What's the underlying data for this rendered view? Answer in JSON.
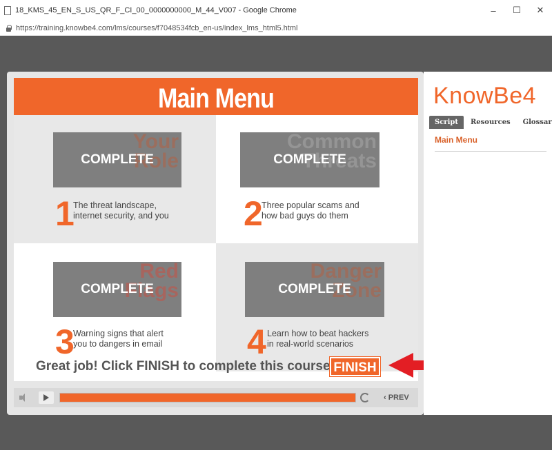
{
  "window": {
    "title": "18_KMS_45_EN_S_US_QR_F_CI_00_0000000000_M_44_V007 - Google Chrome",
    "minimize": "–",
    "maximize": "☐",
    "close": "✕"
  },
  "address": {
    "url": "https://training.knowbe4.com/lms/courses/f7048534fcb_en-us/index_lms_html5.html"
  },
  "slide": {
    "heading": "Main Menu",
    "modules": [
      {
        "number": "1",
        "badge": "COMPLETE",
        "bg_word": "Your Role",
        "line1": "The threat landscape,",
        "line2": "internet security, and you"
      },
      {
        "number": "2",
        "badge": "COMPLETE",
        "bg_word": "Common Threats",
        "line1": "Three popular scams and",
        "line2": "how bad guys do them"
      },
      {
        "number": "3",
        "badge": "COMPLETE",
        "bg_word": "Red Flags",
        "line1": "Warning signs that alert",
        "line2": "you to dangers in email"
      },
      {
        "number": "4",
        "badge": "COMPLETE",
        "bg_word": "Danger Zone",
        "line1": "Learn how to beat hackers",
        "line2": "in real-world scenarios"
      }
    ],
    "footer_text": "Great job! Click FINISH to complete this course.",
    "finish_label": "FINISH"
  },
  "controls": {
    "progress_fraction": 1.0,
    "prev_label": "‹ PREV"
  },
  "sidebar": {
    "logo": "KnowBe4",
    "tabs": [
      "Script",
      "Resources",
      "Glossary"
    ],
    "active_tab": "Script",
    "script_item": "Main Menu"
  },
  "colors": {
    "accent": "#f0662a",
    "arrow": "#e31e24"
  }
}
